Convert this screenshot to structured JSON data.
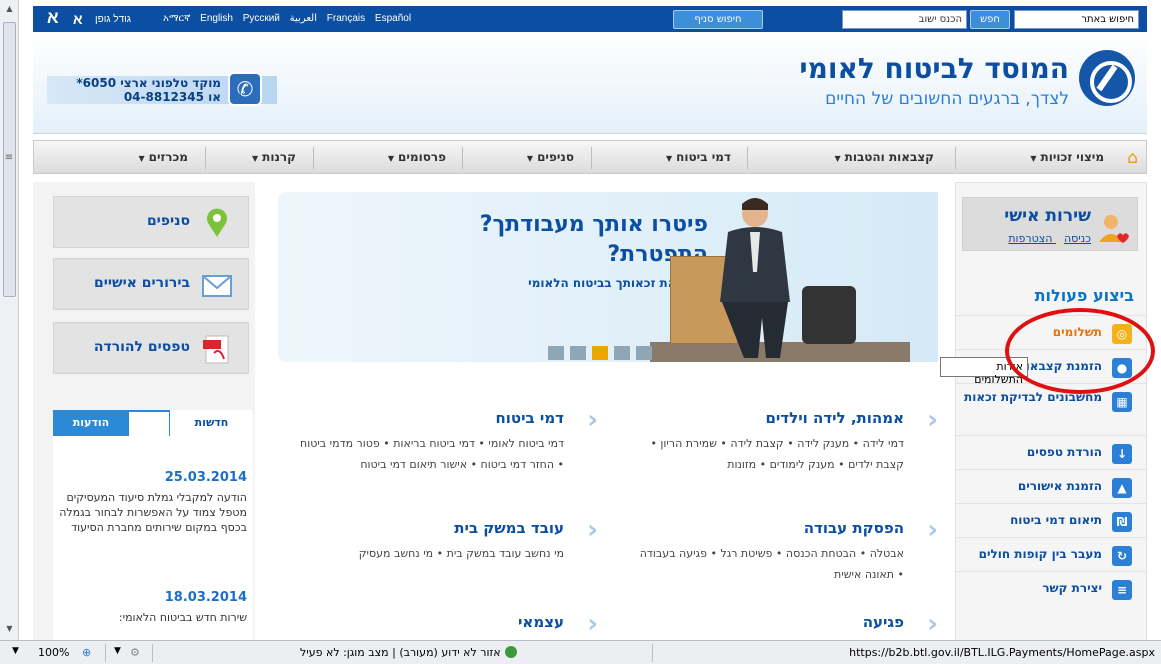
{
  "top_bar": {
    "font_size_labels": [
      "א",
      "א",
      "גודל גופן"
    ],
    "languages": [
      "አማርኛ",
      "English",
      "Русский",
      "العربية",
      "Français",
      "Español"
    ],
    "branch_search_button": "חיפוש סניף",
    "city_placeholder": "הכנס ישוב",
    "search_button": "חפש",
    "site_search_placeholder": "חיפוש באתר"
  },
  "header": {
    "org_name": "המוסד לביטוח לאומי",
    "slogan": "לצדך, ברגעים החשובים של החיים",
    "phone_line1": "מוקד טלפוני ארצי 6050*",
    "phone_line2": "או 04-8812345"
  },
  "nav": {
    "items": [
      "מיצוי זכויות",
      "קצבאות והטבות",
      "דמי ביטוח",
      "סניפים",
      "פרסומים",
      "קרנות",
      "מכרזים"
    ]
  },
  "personal_service": {
    "title": "שירות אישי",
    "login": "כניסה",
    "register": "הצטרפות"
  },
  "actions": {
    "title": "ביצוע פעולות",
    "items": [
      "תשלומים",
      "הזמנת קצבאות",
      "מחשבונים לבדיקת זכאות",
      "הורדת טפסים",
      "הזמנת אישורים",
      "תיאום דמי ביטוח",
      "מעבר בין קופות חולים",
      "יצירת קשר"
    ],
    "tooltip": "אודות התשלומים"
  },
  "banner": {
    "headline": "פיטרו אותך מעבודתך? התפטרת?",
    "sub": "בדוק את זכאותך בביטוח הלאומי"
  },
  "left_links": [
    "סניפים",
    "בירורים אישיים",
    "טפסים להורדה"
  ],
  "news": {
    "tabs": [
      "הודעות לעתונות",
      "חדשות"
    ],
    "entries": [
      {
        "date": "25.03.2014",
        "text": "הודעה למקבלי גמלת סיעוד המעסיקים מטפל צמוד על האפשרות לבחור בגמלה בכסף במקום שירותים מחברת הסיעוד"
      },
      {
        "date": "18.03.2014",
        "text": "שירות חדש בביטוח הלאומי:"
      }
    ]
  },
  "categories": [
    {
      "title": "אמהות, לידה וילדים",
      "text": "דמי לידה • מענק לידה • קצבת לידה • שמירת הריון • קצבת ילדים • מענק לימודים • מזונות"
    },
    {
      "title": "דמי ביטוח",
      "text": "דמי ביטוח לאומי • דמי ביטוח בריאות • פטור מדמי ביטוח • החזר דמי ביטוח • אישור תיאום דמי ביטוח"
    },
    {
      "title": "הפסקת עבודה",
      "text": "אבטלה • הבטחת הכנסה • פשיטת רגל • פגיעה בעבודה • תאונה אישית"
    },
    {
      "title": "עובד במשק בית",
      "text": "מי נחשב עובד במשק בית • מי נחשב מעסיק"
    },
    {
      "title": "פגיעה",
      "text": ""
    },
    {
      "title": "עצמאי",
      "text": ""
    }
  ],
  "status_bar": {
    "url": "https://b2b.btl.gov.il/BTL.ILG.Payments/HomePage.aspx",
    "zone": "אזור לא ידוע (מעורב) | מצב מוגן: לא פעיל",
    "zoom": "100%"
  }
}
